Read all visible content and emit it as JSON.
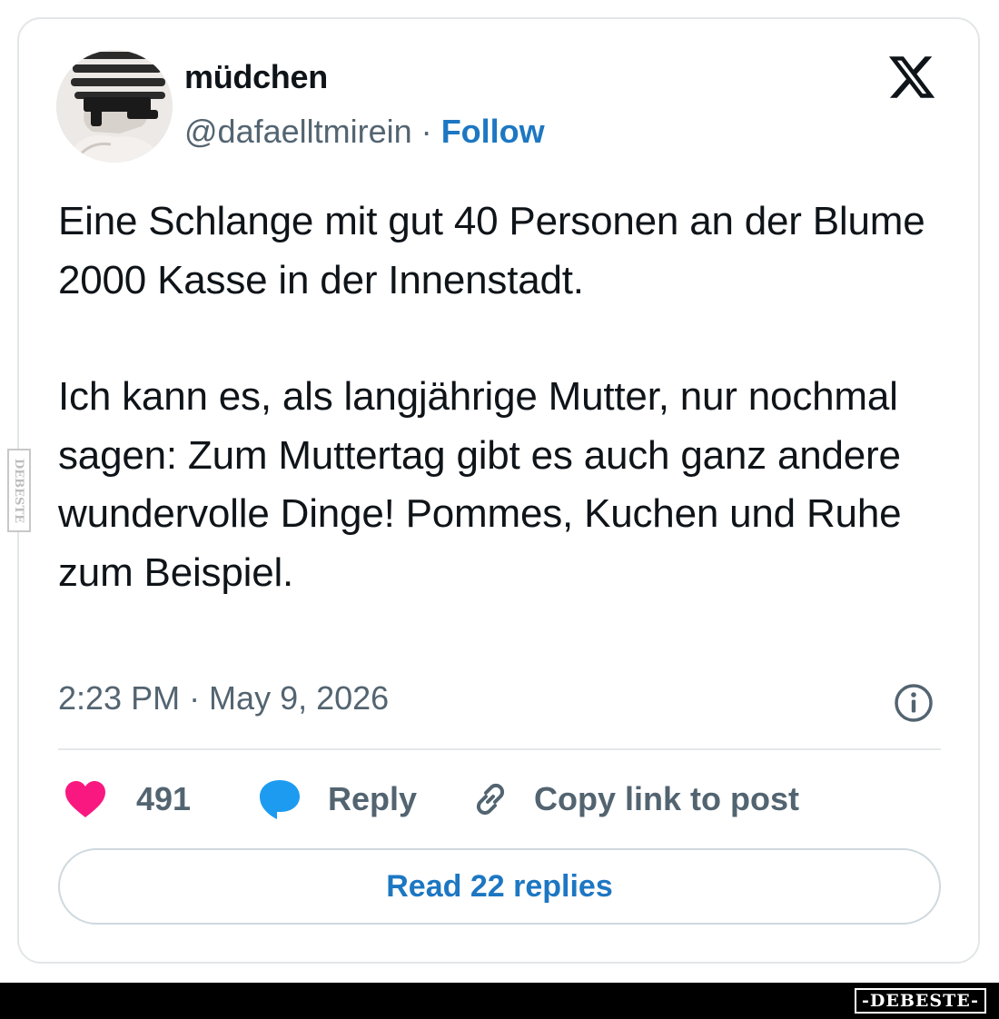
{
  "user": {
    "display_name": "müdchen",
    "handle": "@dafaelltmirein",
    "separator": "·",
    "follow_label": "Follow"
  },
  "tweet": {
    "paragraph_1": "Eine Schlange mit gut 40 Personen an der Blume 2000 Kasse in der Innenstadt.",
    "paragraph_2": "Ich kann es, als langjährige Mutter, nur nochmal sagen: Zum Muttertag gibt es auch ganz andere wundervolle Dinge! Pommes, Kuchen und Ruhe zum Beispiel.",
    "timestamp": "2:23 PM · May 9, 2026"
  },
  "actions": {
    "like_count": "491",
    "reply_label": "Reply",
    "copy_link_label": "Copy link to post",
    "read_replies_label": "Read 22 replies"
  },
  "colors": {
    "link_blue": "#1d77c2",
    "heart": "#f91880",
    "reply_bubble": "#1d9bf0",
    "muted_text": "#536471"
  },
  "icons": [
    "x-logo-icon",
    "info-icon",
    "heart-icon",
    "reply-bubble-icon",
    "link-icon"
  ],
  "watermark": {
    "side_text": "DEBESTE",
    "footer_text": "-DEBESTE-"
  }
}
